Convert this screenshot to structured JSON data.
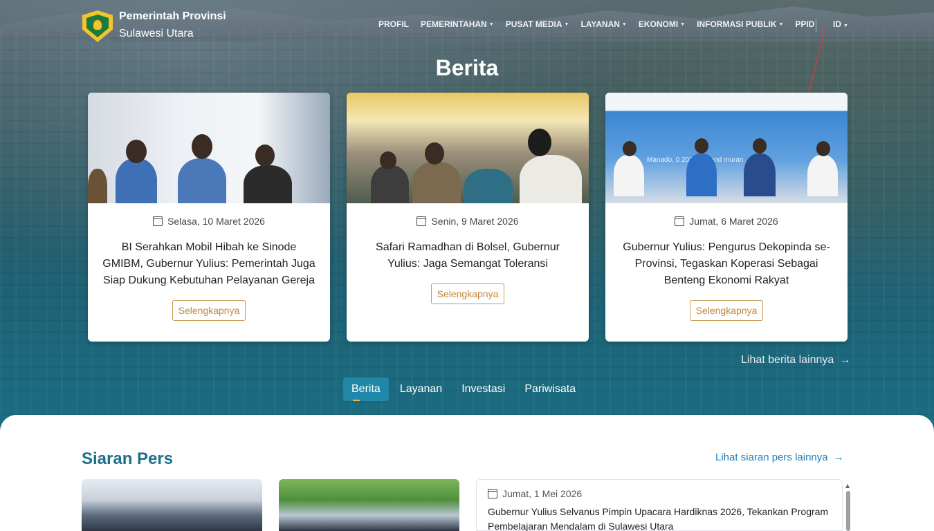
{
  "header": {
    "brand_line1": "Pemerintah Provinsi",
    "brand_line2": "Sulawesi Utara",
    "nav": [
      {
        "label": "PROFIL",
        "dropdown": false
      },
      {
        "label": "PEMERINTAHAN",
        "dropdown": true
      },
      {
        "label": "PUSAT MEDIA",
        "dropdown": true
      },
      {
        "label": "LAYANAN",
        "dropdown": true
      },
      {
        "label": "EKONOMI",
        "dropdown": true
      },
      {
        "label": "INFORMASI PUBLIK",
        "dropdown": true
      },
      {
        "label": "PPID",
        "dropdown": false
      }
    ],
    "language": "ID"
  },
  "news": {
    "title": "Berita",
    "cards": [
      {
        "date": "Selasa, 10 Maret 2026",
        "title": "BI Serahkan Mobil Hibah ke Sinode GMIBM, Gubernur Yulius: Pemerintah Juga Siap Dukung Kebutuhan Pelayanan Gereja",
        "button": "Selengkapnya"
      },
      {
        "date": "Senin, 9 Maret 2026",
        "title": "Safari Ramadhan di Bolsel, Gubernur Yulius: Jaga Semangat Toleransi",
        "button": "Selengkapnya"
      },
      {
        "date": "Jumat, 6 Maret 2026",
        "title": "Gubernur Yulius: Pengurus Dekopinda se-Provinsi, Tegaskan Koperasi Sebagai Benteng Ekonomi Rakyat",
        "button": "Selengkapnya"
      }
    ],
    "see_more": "Lihat berita lainnya",
    "photo3_caption": "Manado, 0      2026 | Grand      muran"
  },
  "tabs": [
    "Berita",
    "Layanan",
    "Investasi",
    "Pariwisata"
  ],
  "active_tab": "Berita",
  "press": {
    "title": "Siaran Pers",
    "see_more": "Lihat siaran pers lainnya",
    "items": [
      {
        "date": "Jumat, 1 Mei 2026",
        "title": "Gubernur Yulius Selvanus Pimpin Upacara Hardiknas 2026, Tekankan Program Pembelajaran Mendalam di Sulawesi Utara"
      }
    ]
  },
  "colors": {
    "accent_button": "#c28638",
    "tab_active": "#1f88a8",
    "press_title": "#1e6f8c",
    "link": "#1e7fb5"
  }
}
